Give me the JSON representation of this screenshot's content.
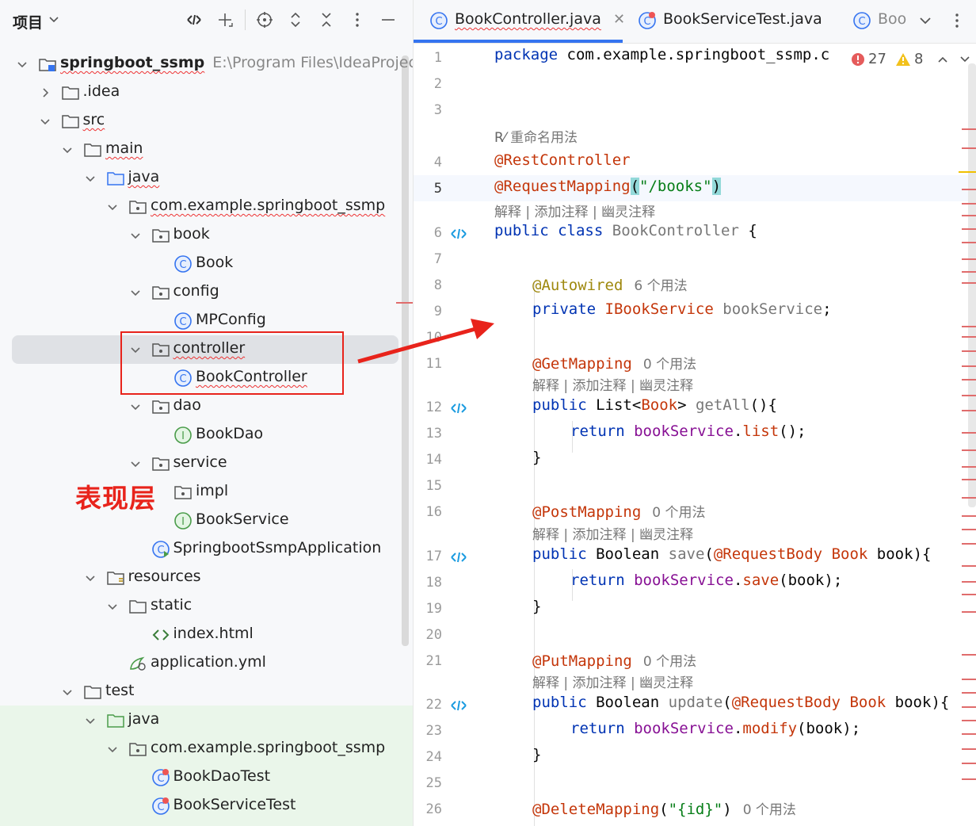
{
  "project_panel": {
    "title": "项目",
    "tree": [
      {
        "label": "springboot_ssmp",
        "sub": "E:\\Program Files\\IdeaProjects\\sp",
        "icon": "module-folder-icon"
      },
      {
        "label": ".idea",
        "icon": "folder-icon"
      },
      {
        "label": "src",
        "icon": "folder-icon"
      },
      {
        "label": "main",
        "icon": "folder-icon"
      },
      {
        "label": "java",
        "icon": "source-folder-icon"
      },
      {
        "label": "com.example.springboot_ssmp",
        "icon": "package-icon"
      },
      {
        "label": "book",
        "icon": "package-icon"
      },
      {
        "label": "Book",
        "icon": "class-icon"
      },
      {
        "label": "config",
        "icon": "package-icon"
      },
      {
        "label": "MPConfig",
        "icon": "class-icon"
      },
      {
        "label": "controller",
        "icon": "package-icon"
      },
      {
        "label": "BookController",
        "icon": "class-icon"
      },
      {
        "label": "dao",
        "icon": "package-icon"
      },
      {
        "label": "BookDao",
        "icon": "interface-icon"
      },
      {
        "label": "service",
        "icon": "package-icon"
      },
      {
        "label": "impl",
        "icon": "package-icon"
      },
      {
        "label": "BookService",
        "icon": "interface-icon"
      },
      {
        "label": "SpringbootSsmpApplication",
        "icon": "spring-boot-class-icon"
      },
      {
        "label": "resources",
        "icon": "resources-folder-icon"
      },
      {
        "label": "static",
        "icon": "folder-icon"
      },
      {
        "label": "index.html",
        "icon": "html-file-icon"
      },
      {
        "label": "application.yml",
        "icon": "yaml-file-icon"
      },
      {
        "label": "test",
        "icon": "folder-icon"
      },
      {
        "label": "java",
        "icon": "test-source-folder-icon"
      },
      {
        "label": "com.example.springboot_ssmp",
        "icon": "package-icon"
      },
      {
        "label": "BookDaoTest",
        "icon": "test-class-icon"
      },
      {
        "label": "BookServiceTest",
        "icon": "test-class-icon"
      }
    ]
  },
  "annotation": {
    "label": "表现层",
    "color": "#e8231b"
  },
  "editor": {
    "tabs": [
      {
        "label": "BookController.java",
        "active": true
      },
      {
        "label": "BookServiceTest.java",
        "active": false
      },
      {
        "label": "Boo",
        "active": false
      }
    ],
    "inspections": {
      "errors": "27",
      "warnings": "8"
    },
    "rename_hint": "重命名用法",
    "hints": {
      "explain": "解释 | 添加注释 | 幽灵注释"
    },
    "code": {
      "package": "package",
      "package_name": " com.example.springboot_ssmp.c",
      "rest_controller": "@RestController",
      "request_mapping": "@RequestMapping",
      "books_path": "\"/books\"",
      "public": "public",
      "class": "class",
      "class_name": "BookController",
      "autowired": "@Autowired",
      "autowired_usages": "6 个用法",
      "private": "private",
      "service_type": "IBookService",
      "service_var": "bookService",
      "get_mapping": "@GetMapping",
      "get_usages": "0 个用法",
      "list_type": "List",
      "book_type": "Book",
      "get_all": "getAll",
      "return": "return",
      "list_call": "list",
      "post_mapping": "@PostMapping",
      "post_usages": "0 个用法",
      "boolean_type": "Boolean",
      "save": "save",
      "request_body": "@RequestBody",
      "book_param": "book",
      "put_mapping": "@PutMapping",
      "put_usages": "0 个用法",
      "update": "update",
      "modify": "modify",
      "delete_mapping": "@DeleteMapping",
      "id_path": "\"{id}\"",
      "delete_usages": "0 个用法"
    },
    "line_numbers": [
      "1",
      "2",
      "3",
      "4",
      "5",
      "6",
      "7",
      "8",
      "9",
      "10",
      "11",
      "12",
      "13",
      "14",
      "15",
      "16",
      "17",
      "18",
      "19",
      "20",
      "21",
      "22",
      "23",
      "24",
      "25",
      "26"
    ]
  }
}
